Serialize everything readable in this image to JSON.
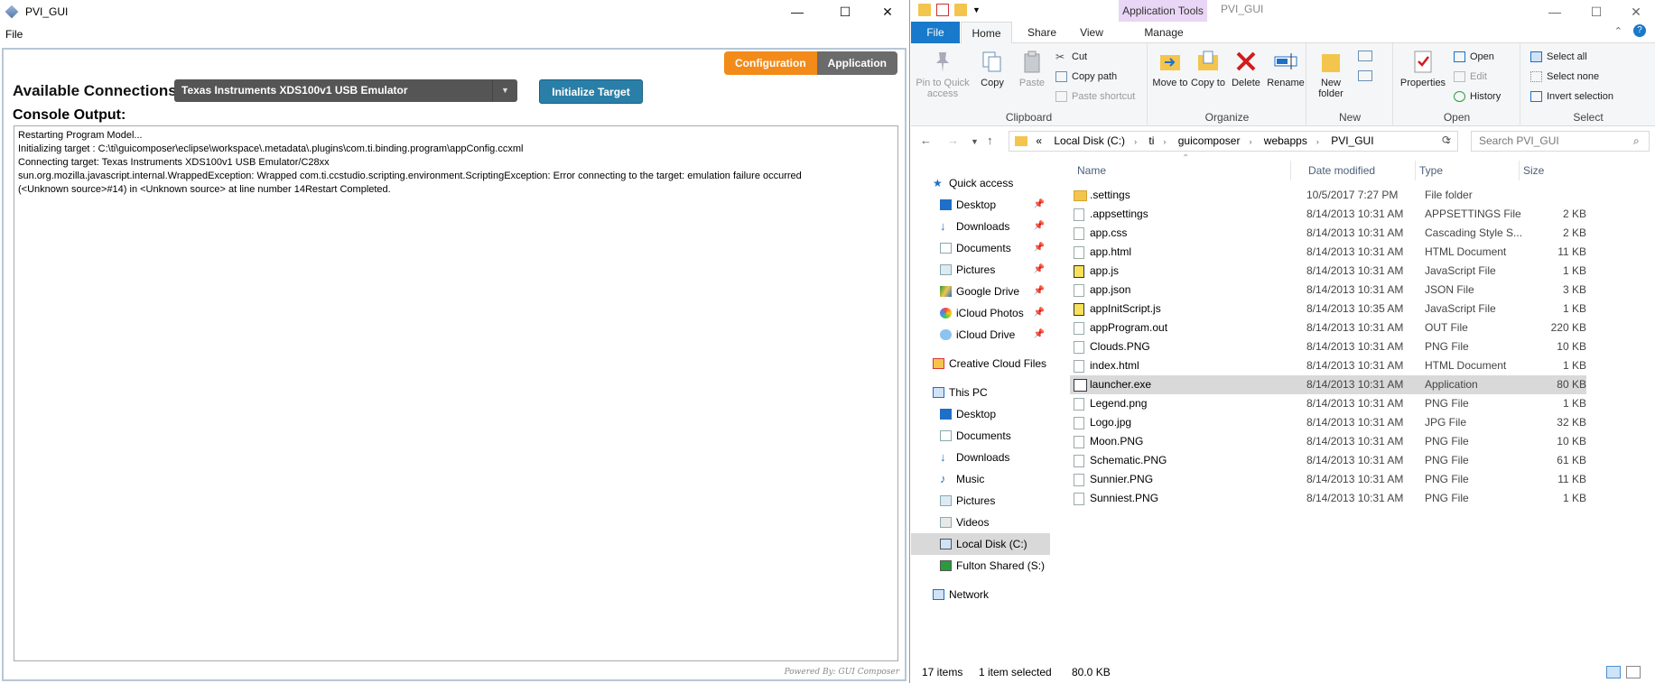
{
  "left_window": {
    "title": "PVI_GUI",
    "controls": {
      "minimize": "—",
      "maximize": "☐",
      "close": "✕"
    },
    "menu": [
      "File"
    ],
    "mode_buttons": {
      "configuration": "Configuration",
      "application": "Application"
    },
    "connections_label": "Available Connections:",
    "connection_selected": "Texas Instruments XDS100v1 USB Emulator",
    "init_button": "Initialize Target",
    "console_label": "Console Output:",
    "console_lines": [
      "Restarting Program Model...",
      "Initializing target : C:\\ti\\guicomposer\\eclipse\\workspace\\.metadata\\.plugins\\com.ti.binding.program\\appConfig.ccxml",
      "Connecting target: Texas Instruments XDS100v1 USB Emulator/C28xx",
      "sun.org.mozilla.javascript.internal.WrappedException: Wrapped com.ti.ccstudio.scripting.environment.ScriptingException: Error connecting to the target: emulation failure occurred",
      "(<Unknown source>#14) in <Unknown source> at line number 14Restart Completed."
    ],
    "powered_by": "Powered By: GUI Composer"
  },
  "explorer": {
    "app_tools": "Application Tools",
    "title": "PVI_GUI",
    "controls": {
      "minimize": "—",
      "maximize": "☐",
      "close": "✕"
    },
    "tabs": {
      "file": "File",
      "home": "Home",
      "share": "Share",
      "view": "View",
      "manage": "Manage"
    },
    "ribbon": {
      "clipboard": {
        "label": "Clipboard",
        "pin": "Pin to Quick access",
        "copy": "Copy",
        "paste": "Paste",
        "cut": "Cut",
        "copy_path": "Copy path",
        "paste_shortcut": "Paste shortcut"
      },
      "organize": {
        "label": "Organize",
        "move_to": "Move to",
        "copy_to": "Copy to",
        "delete": "Delete",
        "rename": "Rename"
      },
      "new": {
        "label": "New",
        "new_folder": "New folder"
      },
      "open": {
        "label": "Open",
        "properties": "Properties",
        "open": "Open",
        "edit": "Edit",
        "history": "History"
      },
      "select": {
        "label": "Select",
        "select_all": "Select all",
        "select_none": "Select none",
        "invert": "Invert selection"
      }
    },
    "address": [
      "Local Disk (C:)",
      "ti",
      "guicomposer",
      "webapps",
      "PVI_GUI"
    ],
    "address_prefix": "«",
    "search_placeholder": "Search PVI_GUI",
    "nav": {
      "quick_access": "Quick access",
      "quick": [
        "Desktop",
        "Downloads",
        "Documents",
        "Pictures",
        "Google Drive",
        "iCloud Photos",
        "iCloud Drive"
      ],
      "creative_cloud": "Creative Cloud Files",
      "this_pc": "This PC",
      "pc": [
        "Desktop",
        "Documents",
        "Downloads",
        "Music",
        "Pictures",
        "Videos",
        "Local Disk (C:)",
        "Fulton Shared (S:)"
      ],
      "network": "Network"
    },
    "columns": {
      "name": "Name",
      "date": "Date modified",
      "type": "Type",
      "size": "Size"
    },
    "files": [
      {
        "name": ".settings",
        "date": "10/5/2017 7:27 PM",
        "type": "File folder",
        "size": "",
        "icon": "folder-icon"
      },
      {
        "name": ".appsettings",
        "date": "8/14/2013 10:31 AM",
        "type": "APPSETTINGS File",
        "size": "2 KB",
        "icon": "file-icon"
      },
      {
        "name": "app.css",
        "date": "8/14/2013 10:31 AM",
        "type": "Cascading Style S...",
        "size": "2 KB",
        "icon": "file-icon"
      },
      {
        "name": "app.html",
        "date": "8/14/2013 10:31 AM",
        "type": "HTML Document",
        "size": "11 KB",
        "icon": "file-icon"
      },
      {
        "name": "app.js",
        "date": "8/14/2013 10:31 AM",
        "type": "JavaScript File",
        "size": "1 KB",
        "icon": "js-icon"
      },
      {
        "name": "app.json",
        "date": "8/14/2013 10:31 AM",
        "type": "JSON File",
        "size": "3 KB",
        "icon": "file-icon"
      },
      {
        "name": "appInitScript.js",
        "date": "8/14/2013 10:35 AM",
        "type": "JavaScript File",
        "size": "1 KB",
        "icon": "js-icon"
      },
      {
        "name": "appProgram.out",
        "date": "8/14/2013 10:31 AM",
        "type": "OUT File",
        "size": "220 KB",
        "icon": "file-icon"
      },
      {
        "name": "Clouds.PNG",
        "date": "8/14/2013 10:31 AM",
        "type": "PNG File",
        "size": "10 KB",
        "icon": "image-icon"
      },
      {
        "name": "index.html",
        "date": "8/14/2013 10:31 AM",
        "type": "HTML Document",
        "size": "1 KB",
        "icon": "file-icon"
      },
      {
        "name": "launcher.exe",
        "date": "8/14/2013 10:31 AM",
        "type": "Application",
        "size": "80 KB",
        "icon": "exe-icon"
      },
      {
        "name": "Legend.png",
        "date": "8/14/2013 10:31 AM",
        "type": "PNG File",
        "size": "1 KB",
        "icon": "image-icon"
      },
      {
        "name": "Logo.jpg",
        "date": "8/14/2013 10:31 AM",
        "type": "JPG File",
        "size": "32 KB",
        "icon": "image-icon"
      },
      {
        "name": "Moon.PNG",
        "date": "8/14/2013 10:31 AM",
        "type": "PNG File",
        "size": "10 KB",
        "icon": "image-icon"
      },
      {
        "name": "Schematic.PNG",
        "date": "8/14/2013 10:31 AM",
        "type": "PNG File",
        "size": "61 KB",
        "icon": "image-icon"
      },
      {
        "name": "Sunnier.PNG",
        "date": "8/14/2013 10:31 AM",
        "type": "PNG File",
        "size": "11 KB",
        "icon": "image-icon"
      },
      {
        "name": "Sunniest.PNG",
        "date": "8/14/2013 10:31 AM",
        "type": "PNG File",
        "size": "1 KB",
        "icon": "image-icon"
      }
    ],
    "selected_file": "launcher.exe",
    "status": {
      "items": "17 items",
      "selected": "1 item selected",
      "size": "80.0 KB"
    },
    "colors": {
      "file_tab": "#1979ca",
      "app_tools": "#e9d5f5",
      "config_btn": "#f28b1a",
      "init_btn": "#2a7fa8"
    }
  }
}
